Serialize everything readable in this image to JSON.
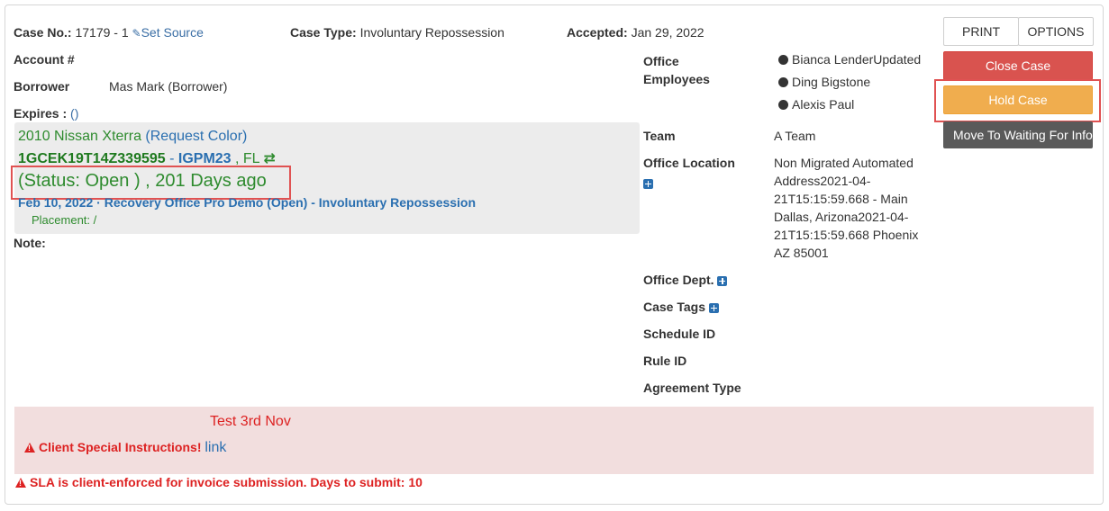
{
  "header": {
    "case_no_label": "Case No.:",
    "case_no_value": "17179 - 1",
    "set_source_link": "Set Source",
    "case_type_label": "Case Type:",
    "case_type_value": "Involuntary Repossession",
    "accepted_label": "Accepted:",
    "accepted_value": "Jan 29, 2022"
  },
  "account": {
    "account_label": "Account #",
    "borrower_label": "Borrower",
    "borrower_value": "Mas Mark (Borrower)",
    "expires_label": "Expires :",
    "expires_value": "()"
  },
  "vehicle": {
    "name": "2010 Nissan Xterra",
    "request_color_link": "(Request Color)",
    "vin": "1GCEK19T14Z339595",
    "separator": " - ",
    "plate": "IGPM23",
    "state": " , FL",
    "swap_symbol": "⇄",
    "status_text": "(Status: Open ) , 201 Days ago",
    "case_link": "Feb 10, 2022 · Recovery Office Pro Demo (Open) - Involuntary Repossession",
    "placement_text": "Placement: /"
  },
  "note_label": "Note:",
  "office": {
    "employees_label_line1": "Office",
    "employees_label_line2": "Employees",
    "employees": [
      "Bianca LenderUpdated",
      "Ding Bigstone",
      "Alexis Paul"
    ],
    "team_label": "Team",
    "team_value": "A Team",
    "location_label": "Office Location",
    "location_value": "Non Migrated Automated Address2021-04-21T15:15:59.668 - Main Dallas, Arizona2021-04-21T15:15:59.668 Phoenix AZ 85001",
    "dept_label": "Office Dept.",
    "case_tags_label": "Case Tags",
    "schedule_id_label": "Schedule ID",
    "rule_id_label": "Rule ID",
    "agreement_type_label": "Agreement Type"
  },
  "buttons": {
    "print": "PRINT",
    "options": "OPTIONS",
    "close_case": "Close Case",
    "hold_case": "Hold Case",
    "move_waiting": "Move To Waiting For Info"
  },
  "instructions": {
    "note_text": "Test 3rd Nov",
    "client_special_label": "Client Special Instructions!",
    "client_special_link": "link",
    "sla_text": "SLA is client-enforced for invoice submission. Days to submit: 10"
  },
  "colors": {
    "status_green": "#2e8b2e",
    "link_blue": "#2a6fb0",
    "close_red": "#d9534f",
    "hold_orange": "#f0ad4e",
    "highlight_red": "#e05252",
    "instructions_bg": "#f2dede"
  }
}
